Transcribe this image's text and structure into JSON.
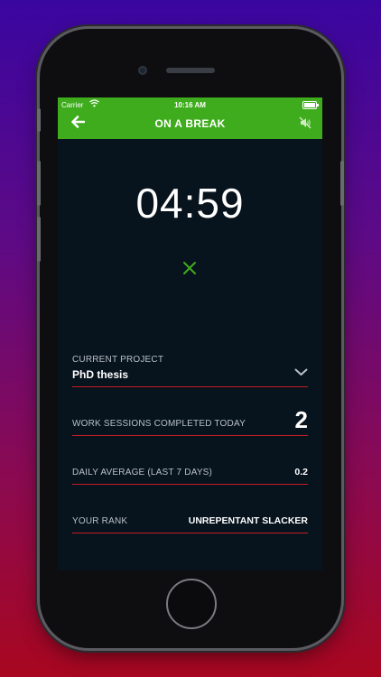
{
  "status": {
    "carrier": "Carrier",
    "time": "10:16 AM"
  },
  "header": {
    "title": "ON A BREAK"
  },
  "timer": {
    "value": "04:59"
  },
  "project": {
    "label": "CURRENT PROJECT",
    "value": "PhD thesis"
  },
  "sessions": {
    "label": "WORK SESSIONS COMPLETED TODAY",
    "value": "2"
  },
  "average": {
    "label": "DAILY AVERAGE (LAST 7 DAYS)",
    "value": "0.2"
  },
  "rank": {
    "label": "YOUR RANK",
    "value": "UNREPENTANT SLACKER"
  },
  "icons": {
    "back": "back-arrow-icon",
    "mute": "speaker-muted-icon",
    "cancel": "close-icon",
    "dropdown": "chevron-down-icon",
    "wifi": "wifi-icon",
    "battery": "battery-icon"
  },
  "colors": {
    "header_bg": "#3eac1c",
    "screen_bg": "#07131d",
    "divider": "#c81e23",
    "cancel_icon": "#3eac1c"
  }
}
